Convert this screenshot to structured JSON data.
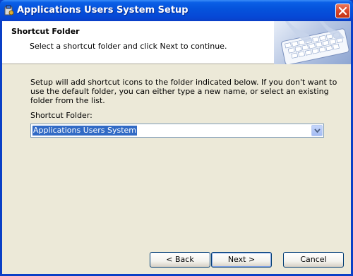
{
  "window": {
    "title": "Applications Users System Setup",
    "icons": {
      "app": "installer-icon",
      "close": "close-icon"
    },
    "colors": {
      "titlebar": "#0553dc",
      "close": "#d8462a",
      "face": "#ece9d8",
      "selection": "#316ac5"
    }
  },
  "header": {
    "title": "Shortcut Folder",
    "subtitle": "Select a shortcut folder and click Next to continue.",
    "image_icon": "keyboard-hands-banner"
  },
  "body": {
    "description": "Setup will add shortcut icons to the folder indicated below. If you don't want to use the default folder, you can either type a new name, or select an existing folder from the list.",
    "folder_label": "Shortcut Folder:",
    "folder_value": "Applications Users System",
    "dropdown_icon": "chevron-down-icon"
  },
  "buttons": {
    "back": "< Back",
    "next": "Next >",
    "cancel": "Cancel"
  }
}
